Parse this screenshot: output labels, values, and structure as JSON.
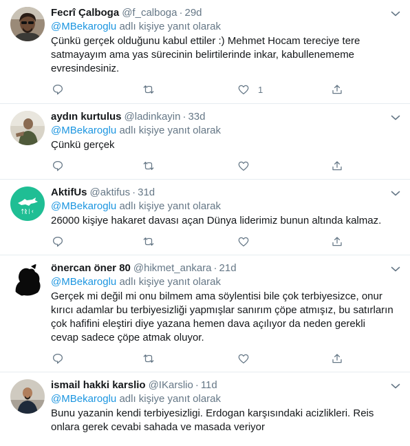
{
  "tweets": [
    {
      "fullname": "Fecrî Çalboga",
      "handle": "@f_calboga",
      "time": "29d",
      "reply_mention": "@MBekaroglu",
      "reply_suffix": "adlı kişiye yanıt olarak",
      "text": "Çünkü gerçek olduğunu kabul ettiler :) Mehmet Hocam tereciye tere satmayayım ama yas sürecinin belirtilerinde inkar, kabullenememe evresindesiniz.",
      "reply_count": "",
      "retweet_count": "",
      "like_count": "1",
      "avatar_icon": "person-sunglasses-avatar"
    },
    {
      "fullname": "aydın kurtulus",
      "handle": "@ladinkayin",
      "time": "33d",
      "reply_mention": "@MBekaroglu",
      "reply_suffix": "adlı kişiye yanıt olarak",
      "text": "Çünkü gerçek",
      "reply_count": "",
      "retweet_count": "",
      "like_count": "",
      "avatar_icon": "person-photo-avatar"
    },
    {
      "fullname": "AktifUs",
      "handle": "@aktifus",
      "time": "31d",
      "reply_mention": "@MBekaroglu",
      "reply_suffix": "adlı kişiye yanıt olarak",
      "text": "26000 kişiye hakaret davası açan Dünya liderimiz bunun altında kalmaz.",
      "reply_count": "",
      "retweet_count": "",
      "like_count": "",
      "avatar_icon": "teal-wolf-logo-avatar"
    },
    {
      "fullname": "önercan öner 80",
      "handle": "@hikmet_ankara",
      "time": "21d",
      "reply_mention": "@MBekaroglu",
      "reply_suffix": "adlı kişiye yanıt olarak",
      "text": "Gerçek mi değil mi onu bilmem ama söylentisi bile çok terbiyesizce, onur kırıcı adamlar bu terbiyesizliği yapmışlar sanırım çöpe atmışız, bu satırların çok hafifini eleştiri diye yazana hemen dava açılıyor da neden gerekli cevap sadece çöpe atmak oluyor.",
      "reply_count": "",
      "retweet_count": "",
      "like_count": "",
      "avatar_icon": "black-silhouette-avatar"
    },
    {
      "fullname": "ismail hakki karslio",
      "handle": "@IKarslio",
      "time": "11d",
      "reply_mention": "@MBekaroglu",
      "reply_suffix": "adlı kişiye yanıt olarak",
      "text": "Bunu yazanin kendi terbiyesizligi. Erdogan karşısındaki acizlikleri. Reis onlara gerek cevabi sahada ve masada veriyor",
      "reply_count": "",
      "retweet_count": "",
      "like_count": "",
      "avatar_icon": "person-portrait-avatar"
    }
  ],
  "colors": {
    "text": "#14171a",
    "secondary": "#657786",
    "mention": "#1b95e0",
    "divider": "#e6ecf0",
    "aktifus_logo": "#1fbe94"
  }
}
